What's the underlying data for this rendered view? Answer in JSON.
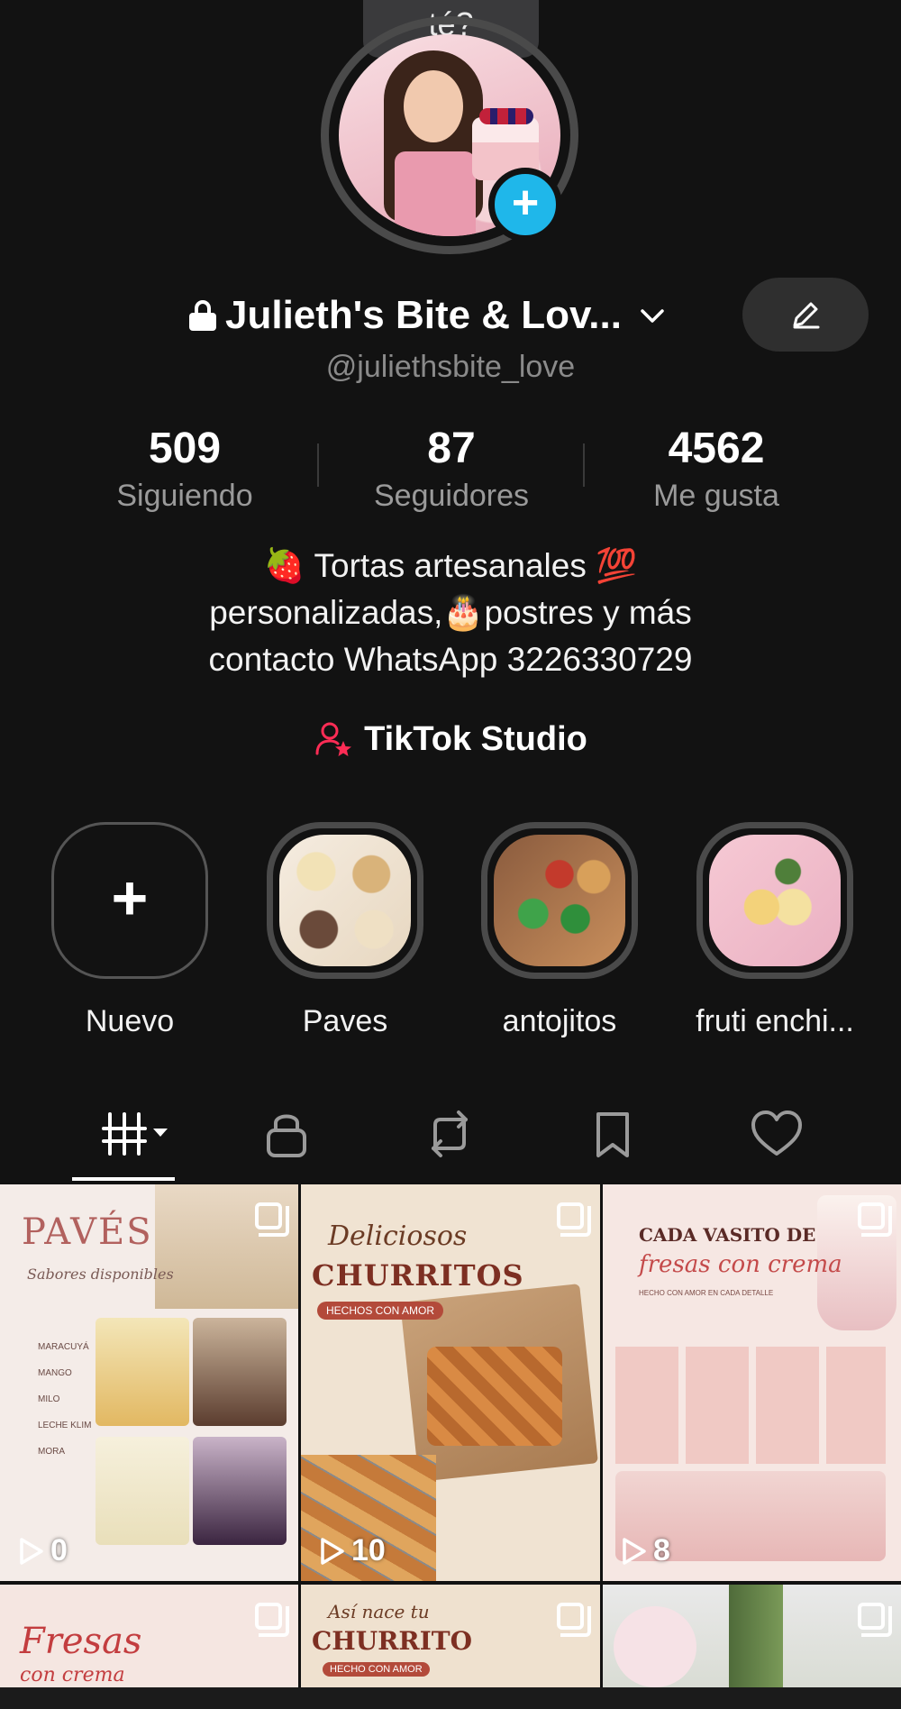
{
  "tooltip": {
    "text": "té?"
  },
  "profile": {
    "display_name": "Julieth's Bite & Lov...",
    "handle": "@juliethsbite_love",
    "avatar_icon": "profile-avatar",
    "add_icon": "plus-icon"
  },
  "stats": [
    {
      "value": "509",
      "label": "Siguiendo"
    },
    {
      "value": "87",
      "label": "Seguidores"
    },
    {
      "value": "4562",
      "label": "Me gusta"
    }
  ],
  "bio": {
    "line1": "🍓 Tortas artesanales 💯",
    "line2": "personalizadas,🎂postres y más",
    "line3": "contacto WhatsApp 3226330729"
  },
  "studio": {
    "label": "TikTok Studio"
  },
  "highlights": [
    {
      "label": "Nuevo"
    },
    {
      "label": "Paves"
    },
    {
      "label": "antojitos"
    },
    {
      "label": "fruti enchi..."
    }
  ],
  "tabs": [
    {
      "icon": "videos-grid-icon",
      "active": true
    },
    {
      "icon": "lock-icon",
      "active": false
    },
    {
      "icon": "repost-icon",
      "active": false
    },
    {
      "icon": "bookmark-icon",
      "active": false
    },
    {
      "icon": "heart-icon",
      "active": false
    }
  ],
  "videos": [
    {
      "views": "0",
      "title": "PAVÉS",
      "subtitle": "Sabores disponibles",
      "items": [
        "MARACUYÁ",
        "MANGO",
        "MILO",
        "LECHE KLIM",
        "MORA"
      ]
    },
    {
      "views": "10",
      "title": "CHURRITOS",
      "subtitle": "Deliciosos",
      "tag": "HECHOS CON AMOR"
    },
    {
      "views": "8",
      "title": "CADA VASITO DE",
      "subtitle": "fresas con crema",
      "tag": "HECHO CON AMOR EN CADA DETALLE"
    },
    {
      "title": "Fresas",
      "subtitle": "con crema"
    },
    {
      "title": "CHURRITO",
      "subtitle": "Así nace tu",
      "tag": "HECHO CON AMOR"
    },
    {
      "title": ""
    }
  ],
  "colors": {
    "accent_blue": "#1fb7ea",
    "studio_pink": "#fe2c55",
    "background": "#121212"
  }
}
